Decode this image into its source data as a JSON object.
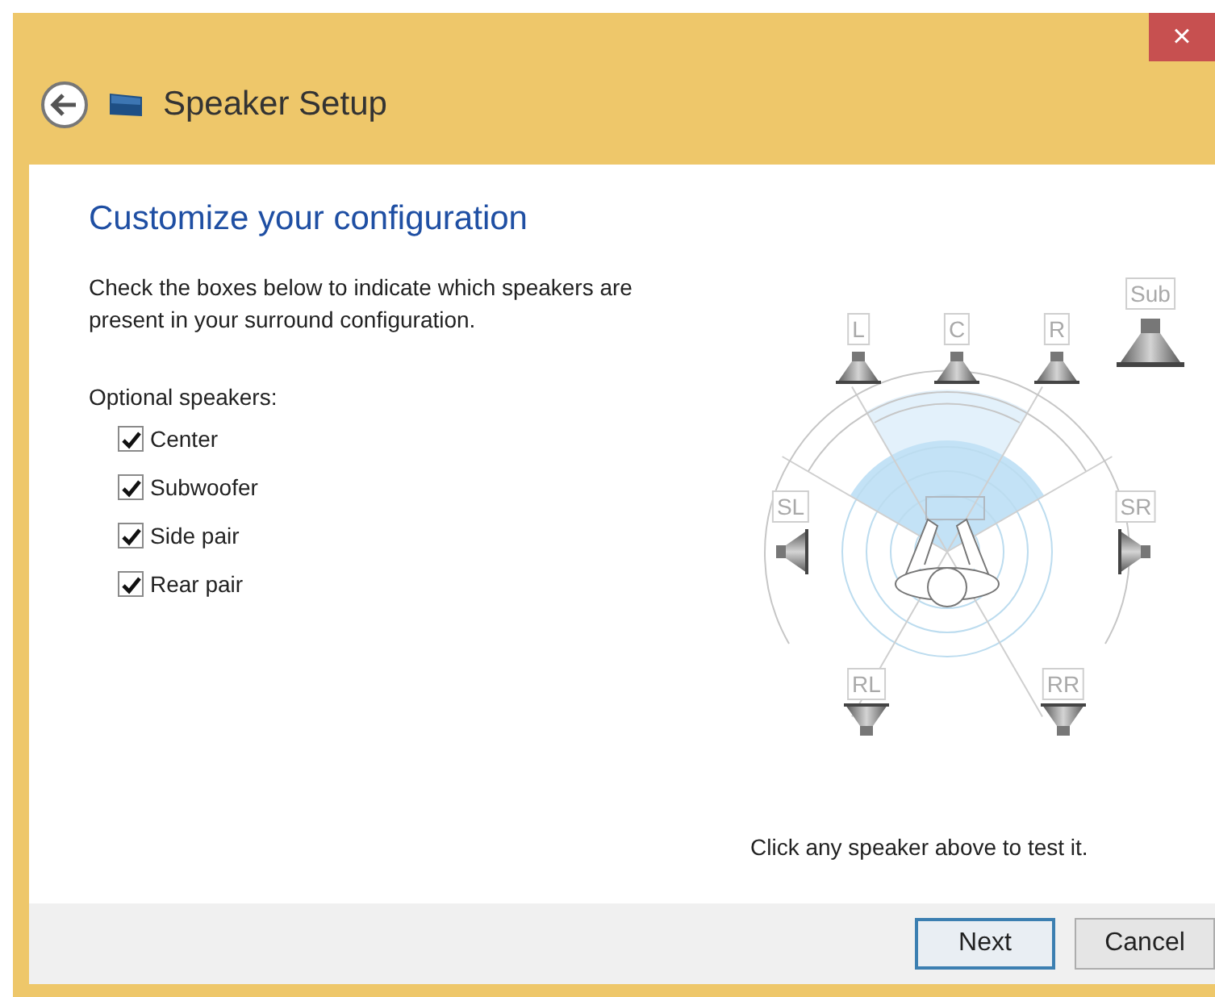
{
  "window": {
    "title": "Speaker Setup",
    "close": "×"
  },
  "heading": "Customize your configuration",
  "instructions": "Check the boxes below to indicate which speakers are present in your surround configuration.",
  "optional_label": "Optional speakers:",
  "options": [
    {
      "label": "Center",
      "checked": true
    },
    {
      "label": "Subwoofer",
      "checked": true
    },
    {
      "label": "Side pair",
      "checked": true
    },
    {
      "label": "Rear pair",
      "checked": true
    }
  ],
  "speakers": [
    {
      "label": "Sub",
      "kind": "sub"
    },
    {
      "label": "L",
      "kind": "front-left"
    },
    {
      "label": "C",
      "kind": "center"
    },
    {
      "label": "R",
      "kind": "front-right"
    },
    {
      "label": "SL",
      "kind": "side-left"
    },
    {
      "label": "SR",
      "kind": "side-right"
    },
    {
      "label": "RL",
      "kind": "rear-left"
    },
    {
      "label": "RR",
      "kind": "rear-right"
    }
  ],
  "hint": "Click any speaker above to test it.",
  "buttons": [
    {
      "label": "Next",
      "default": true
    },
    {
      "label": "Cancel",
      "default": false
    }
  ]
}
